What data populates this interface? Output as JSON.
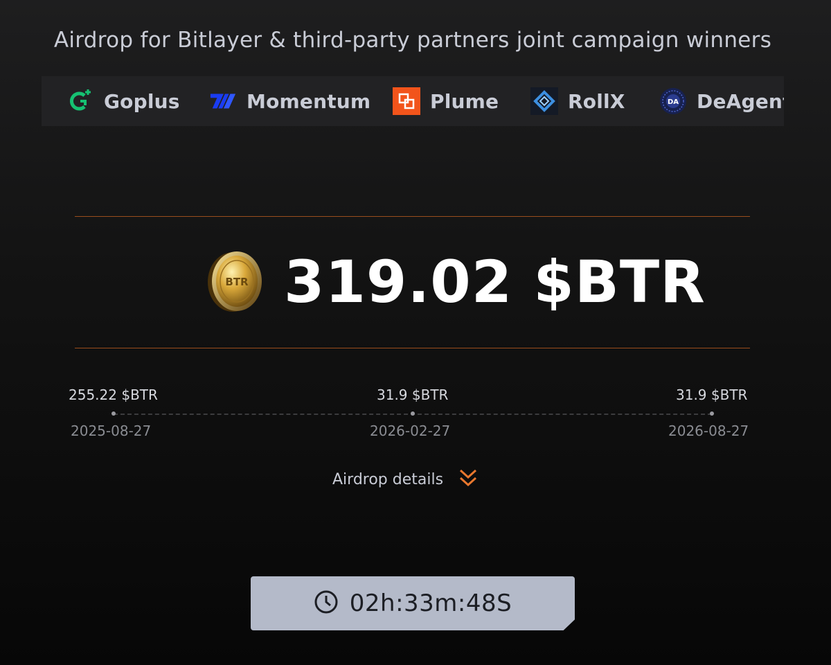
{
  "title": "Airdrop for Bitlayer & third-party partners joint campaign winners",
  "partners": [
    {
      "name": "Goplus",
      "icon": "goplus-logo-icon",
      "color": "#16c172"
    },
    {
      "name": "Momentum",
      "icon": "momentum-logo-icon",
      "color": "#1a3cf2"
    },
    {
      "name": "Plume",
      "icon": "plume-logo-icon",
      "color": "#f2541b"
    },
    {
      "name": "RollX",
      "icon": "rollx-logo-icon",
      "color": "#3d8fe0"
    },
    {
      "name": "DeAgentAI",
      "icon": "deagentai-logo-icon",
      "color": "#2b3c8f"
    }
  ],
  "coin": {
    "label": "BTR",
    "icon": "btr-coin-icon"
  },
  "total_amount": "319.02 $BTR",
  "schedule": [
    {
      "amount": "255.22 $BTR",
      "date": "2025-08-27"
    },
    {
      "amount": "31.9 $BTR",
      "date": "2026-02-27"
    },
    {
      "amount": "31.9 $BTR",
      "date": "2026-08-27"
    }
  ],
  "details": {
    "label": "Airdrop details",
    "icon": "double-chevron-down-icon"
  },
  "countdown": {
    "value": "02h:33m:48S",
    "icon": "clock-icon"
  },
  "colors": {
    "accent": "#e8772e",
    "divider": "#9a4d1d",
    "countdown_bg": "#b4bac9"
  }
}
